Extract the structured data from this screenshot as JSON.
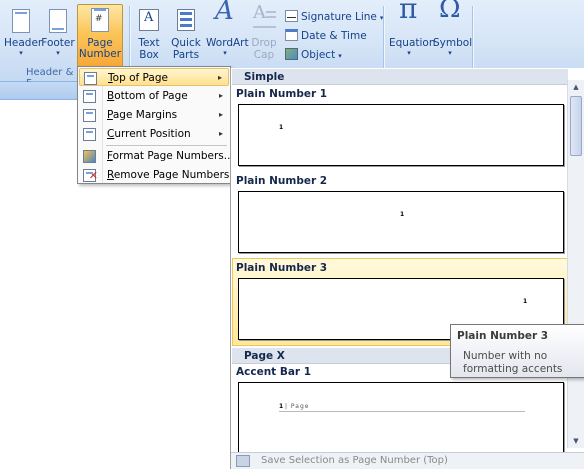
{
  "ribbon": {
    "header_footer_group": {
      "label": "Header & F",
      "header": "Header",
      "footer": "Footer",
      "page_number_line1": "Page",
      "page_number_line2": "Number"
    },
    "text_group": {
      "text_box_line1": "Text",
      "text_box_line2": "Box",
      "quick_parts_line1": "Quick",
      "quick_parts_line2": "Parts",
      "wordart": "WordArt",
      "drop_cap_line1": "Drop",
      "drop_cap_line2": "Cap",
      "signature_line": "Signature Line",
      "date_time": "Date & Time",
      "object": "Object"
    },
    "symbols_group": {
      "equation": "Equation",
      "equation_glyph": "π",
      "symbol": "Symbol",
      "symbol_glyph": "Ω"
    },
    "accent_color": "#f7a839"
  },
  "menu": {
    "items": [
      {
        "key": "T",
        "rest": "op of Page",
        "has_submenu": true,
        "highlighted": true
      },
      {
        "key": "B",
        "rest": "ottom of Page",
        "has_submenu": true
      },
      {
        "key": "P",
        "rest": "age Margins",
        "has_submenu": true
      },
      {
        "key": "C",
        "rest": "urrent Position",
        "has_submenu": true
      },
      {
        "key": "F",
        "rest": "ormat Page Numbers...",
        "has_submenu": false
      },
      {
        "key": "R",
        "rest": "emove Page Numbers",
        "has_submenu": false
      }
    ],
    "submenu_glyph": "▸"
  },
  "gallery": {
    "section_simple": "Simple",
    "section_page_x": "Page X",
    "items": [
      {
        "title": "Plain Number 1",
        "number": "1"
      },
      {
        "title": "Plain Number 2",
        "number": "1"
      },
      {
        "title": "Plain Number 3",
        "number": "1"
      },
      {
        "title": "Accent Bar 1",
        "number": "1",
        "suffix": "| Page"
      }
    ],
    "footer_action": "Save Selection as Page Number (Top)"
  },
  "tooltip": {
    "title": "Plain Number 3",
    "description": "Number with no formatting accents"
  }
}
